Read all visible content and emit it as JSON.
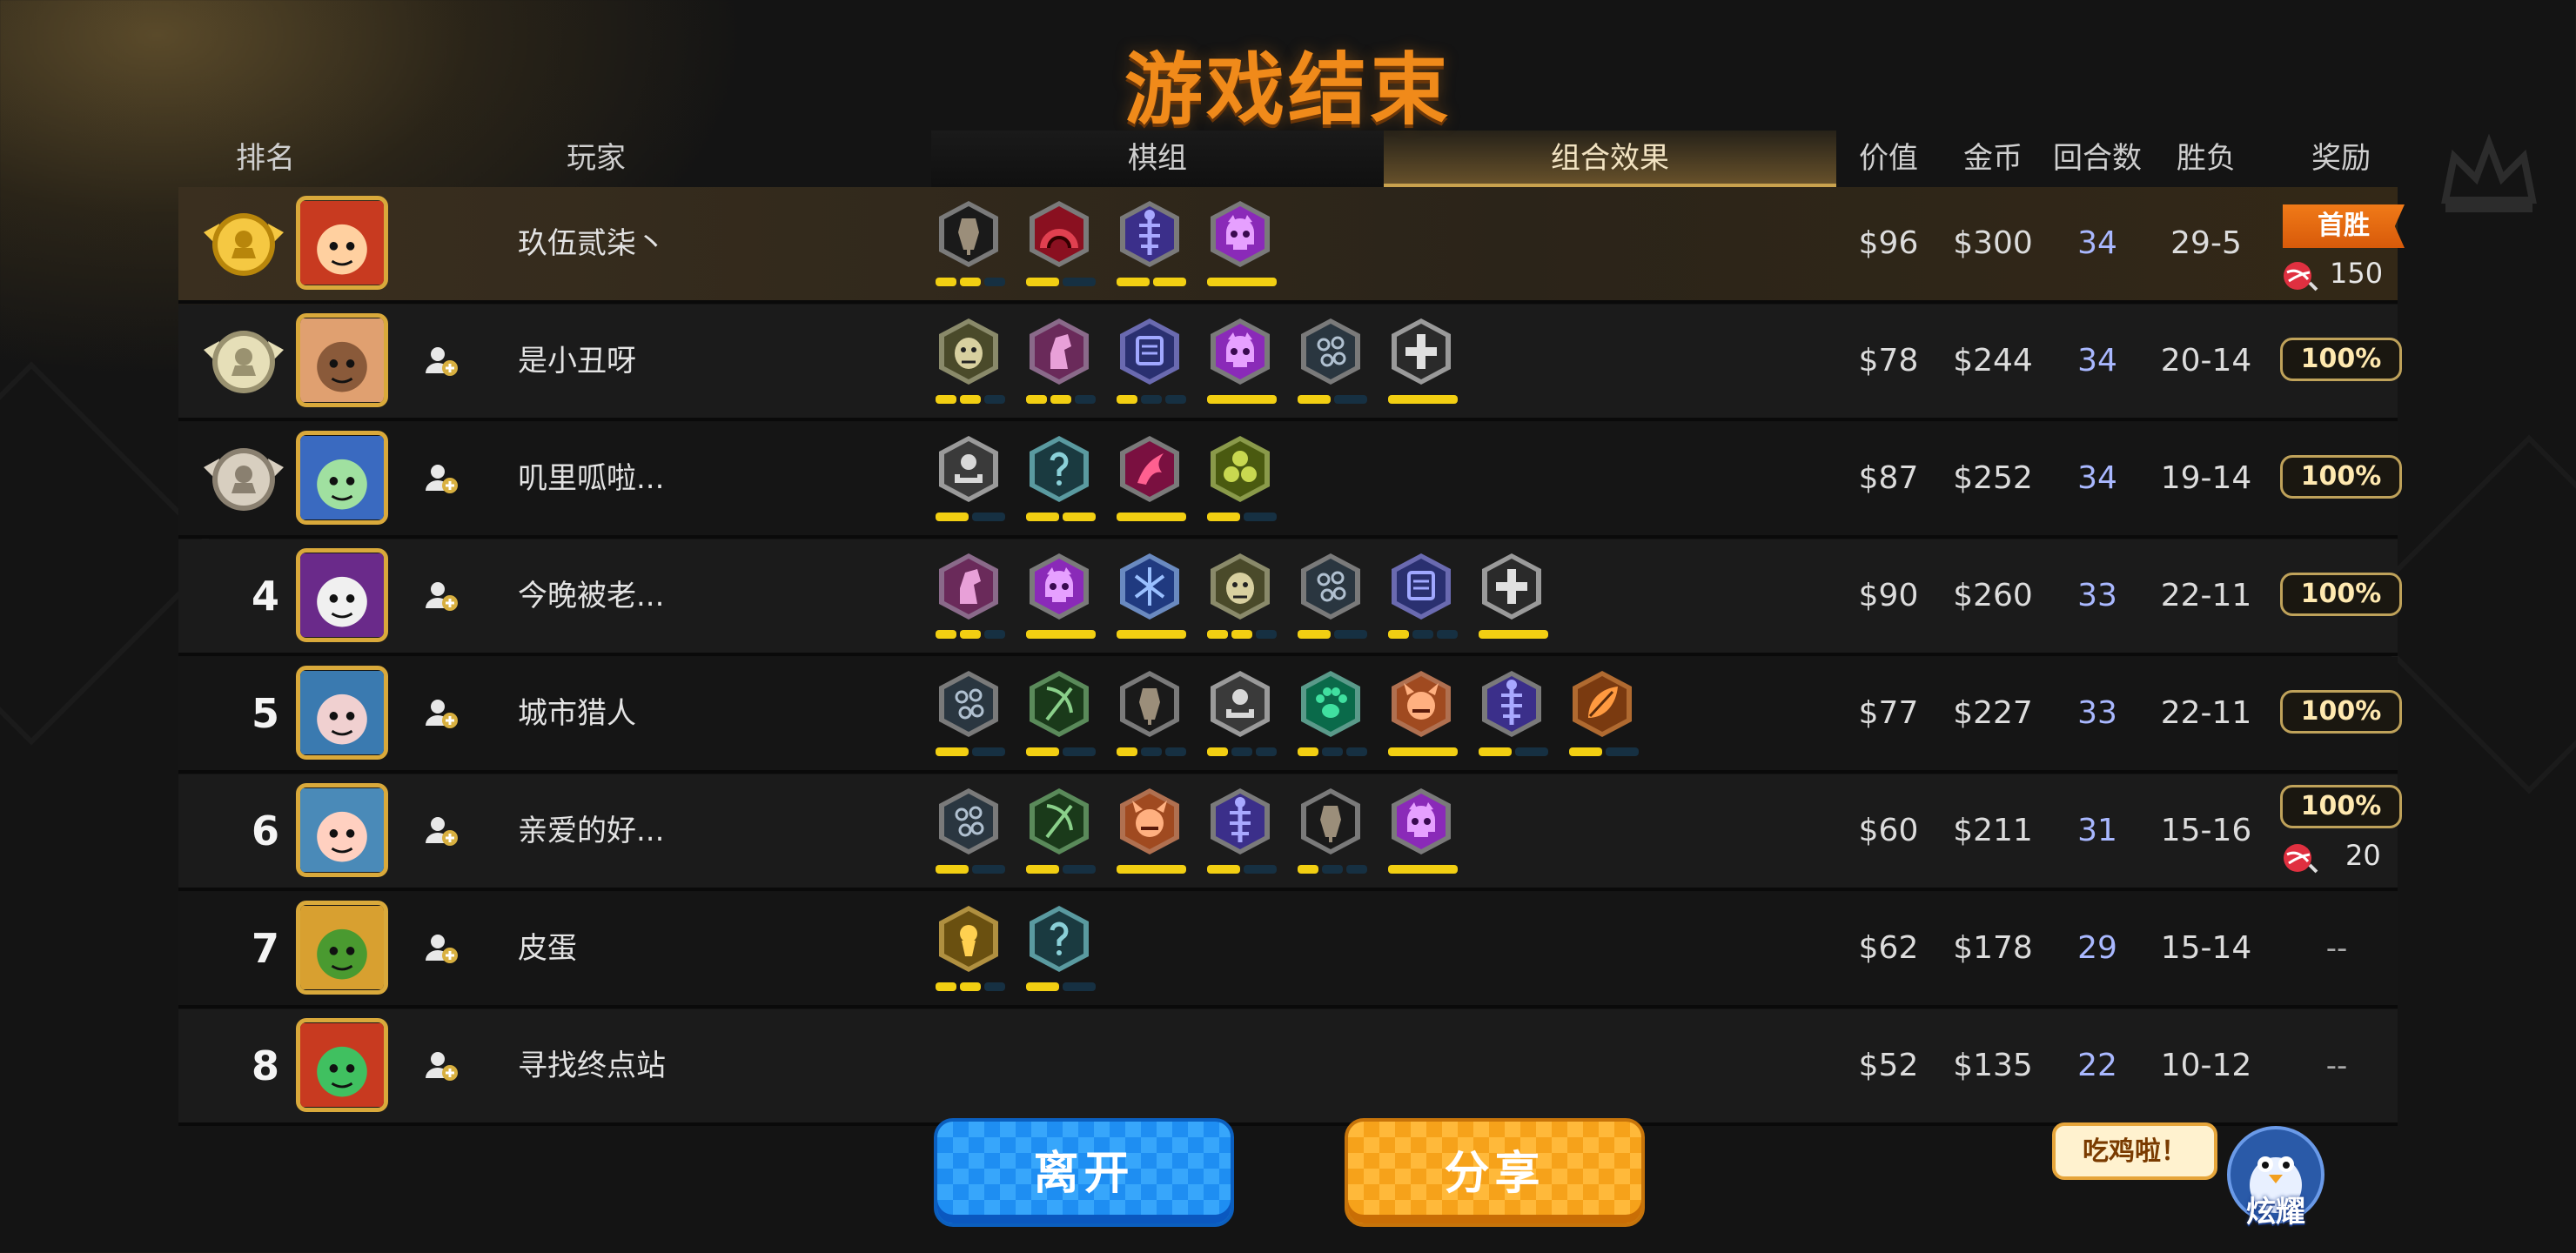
{
  "title": "游戏结束",
  "header": {
    "rank": "排名",
    "player": "玩家",
    "deck_tab": "棋组",
    "combo_tab": "组合效果",
    "value": "价值",
    "gold": "金币",
    "rounds": "回合数",
    "winloss": "胜负",
    "reward": "奖励"
  },
  "colors": {
    "title": "#f08a1a",
    "bar_on": "#f2cf12",
    "bar_off": "#163042",
    "rounds": "#a9b8ff",
    "accent_gold": "#c9a24e"
  },
  "players": [
    {
      "rank": "1",
      "medal": "gold",
      "name": "玖伍贰柒丶",
      "value": "$96",
      "gold": "$300",
      "rounds": "34",
      "winloss": "29-5",
      "reward": {
        "type": "flag",
        "label": "首胜",
        "candy": "150"
      },
      "add_friend": false,
      "traits": [
        {
          "icon": "axe-icon",
          "color": "#1a1a1a",
          "ring": "#7a7a7a",
          "fg": "#9b8e7a",
          "bars": [
            1,
            1,
            0
          ]
        },
        {
          "icon": "arch-icon",
          "color": "#8a1020",
          "ring": "#7a7a7a",
          "fg": "#e04050",
          "bars": [
            1,
            0
          ]
        },
        {
          "icon": "fishbone-icon",
          "color": "#3b2f8a",
          "ring": "#7a7a7a",
          "fg": "#a8a8ff",
          "bars": [
            1,
            1
          ]
        },
        {
          "icon": "skull-icon",
          "color": "#8a2ab8",
          "ring": "#7a7a7a",
          "fg": "#e6a0ff",
          "bars": [
            1
          ]
        }
      ]
    },
    {
      "rank": "2",
      "medal": "silver",
      "name": "是小丑呀",
      "value": "$78",
      "gold": "$244",
      "rounds": "34",
      "winloss": "20-14",
      "reward": {
        "type": "pill",
        "label": "100%"
      },
      "add_friend": true,
      "traits": [
        {
          "icon": "beast-icon",
          "color": "#4a4a2a",
          "ring": "#8a8a6a",
          "fg": "#d8d0a0",
          "bars": [
            1,
            1,
            0
          ]
        },
        {
          "icon": "knight-icon",
          "color": "#6a2a5a",
          "ring": "#8a6a8a",
          "fg": "#e8a0d8",
          "bars": [
            1,
            1,
            0
          ]
        },
        {
          "icon": "scroll-icon",
          "color": "#2a3070",
          "ring": "#6a6ab0",
          "fg": "#a0a8ff",
          "bars": [
            1,
            0,
            0
          ]
        },
        {
          "icon": "skull-icon",
          "color": "#8a2ab8",
          "ring": "#7a7a7a",
          "fg": "#e6a0ff",
          "bars": [
            1
          ]
        },
        {
          "icon": "paw-cluster-icon",
          "color": "#2a3640",
          "ring": "#7a7a7a",
          "fg": "#b0c0d0",
          "bars": [
            1,
            0
          ]
        },
        {
          "icon": "cross-icon",
          "color": "#2a2a2a",
          "ring": "#9a9a9a",
          "fg": "#e0e0e0",
          "bars": [
            1
          ]
        }
      ]
    },
    {
      "rank": "3",
      "medal": "bronze",
      "name": "叽里呱啦...",
      "value": "$87",
      "gold": "$252",
      "rounds": "34",
      "winloss": "19-14",
      "reward": {
        "type": "pill",
        "label": "100%"
      },
      "add_friend": true,
      "traits": [
        {
          "icon": "pedestal-icon",
          "color": "#3a3a3a",
          "ring": "#9a9a9a",
          "fg": "#d8d8d8",
          "bars": [
            1,
            0
          ]
        },
        {
          "icon": "mystery-icon",
          "color": "#1a3a40",
          "ring": "#5a9aa0",
          "fg": "#8ad0d8",
          "bars": [
            1,
            1
          ]
        },
        {
          "icon": "dragon-icon",
          "color": "#7a1040",
          "ring": "#7a7a7a",
          "fg": "#ff6090",
          "bars": [
            1
          ]
        },
        {
          "icon": "triad-icon",
          "color": "#4a5a10",
          "ring": "#8a9a4a",
          "fg": "#c8d850",
          "bars": [
            1,
            0
          ]
        }
      ]
    },
    {
      "rank": "4",
      "medal": "",
      "name": "今晚被老...",
      "value": "$90",
      "gold": "$260",
      "rounds": "33",
      "winloss": "22-11",
      "reward": {
        "type": "pill",
        "label": "100%"
      },
      "add_friend": true,
      "traits": [
        {
          "icon": "knight-icon",
          "color": "#6a2a5a",
          "ring": "#8a6a8a",
          "fg": "#e8a0d8",
          "bars": [
            1,
            1,
            0
          ]
        },
        {
          "icon": "skull-icon",
          "color": "#8a2ab8",
          "ring": "#7a7a7a",
          "fg": "#e6a0ff",
          "bars": [
            1
          ]
        },
        {
          "icon": "shatter-icon",
          "color": "#203a80",
          "ring": "#6a8ac0",
          "fg": "#9ac0ff",
          "bars": [
            1
          ]
        },
        {
          "icon": "beast-icon",
          "color": "#4a4a2a",
          "ring": "#8a8a6a",
          "fg": "#d8d0a0",
          "bars": [
            1,
            1,
            0
          ]
        },
        {
          "icon": "paw-cluster-icon",
          "color": "#2a3640",
          "ring": "#7a7a7a",
          "fg": "#b0c0d0",
          "bars": [
            1,
            0
          ]
        },
        {
          "icon": "scroll-icon",
          "color": "#2a3070",
          "ring": "#6a6ab0",
          "fg": "#a0a8ff",
          "bars": [
            1,
            0,
            0
          ]
        },
        {
          "icon": "cross-icon",
          "color": "#2a2a2a",
          "ring": "#9a9a9a",
          "fg": "#e0e0e0",
          "bars": [
            1
          ]
        }
      ]
    },
    {
      "rank": "5",
      "medal": "",
      "name": "城市猎人",
      "value": "$77",
      "gold": "$227",
      "rounds": "33",
      "winloss": "22-11",
      "reward": {
        "type": "pill",
        "label": "100%"
      },
      "add_friend": true,
      "traits": [
        {
          "icon": "paw-cluster-icon",
          "color": "#2a3640",
          "ring": "#7a7a7a",
          "fg": "#b0c0d0",
          "bars": [
            1,
            0
          ]
        },
        {
          "icon": "bow-icon",
          "color": "#1a3a1a",
          "ring": "#5a8a5a",
          "fg": "#8ad08a",
          "bars": [
            1,
            0
          ]
        },
        {
          "icon": "axe-icon",
          "color": "#1a1a1a",
          "ring": "#7a7a7a",
          "fg": "#9b8e7a",
          "bars": [
            1,
            0,
            0
          ]
        },
        {
          "icon": "pedestal-icon",
          "color": "#3a3a3a",
          "ring": "#9a9a9a",
          "fg": "#d8d8d8",
          "bars": [
            1,
            0,
            0
          ]
        },
        {
          "icon": "paw-icon",
          "color": "#0a6a4a",
          "ring": "#5a9a8a",
          "fg": "#40e0a0",
          "bars": [
            1,
            0,
            0
          ]
        },
        {
          "icon": "demon-icon",
          "color": "#a04a20",
          "ring": "#b07050",
          "fg": "#ffb080",
          "bars": [
            1
          ]
        },
        {
          "icon": "fishbone-icon",
          "color": "#3b2f8a",
          "ring": "#7a7a7a",
          "fg": "#a8a8ff",
          "bars": [
            1,
            0
          ]
        },
        {
          "icon": "leaf-icon",
          "color": "#7a3a10",
          "ring": "#b06a30",
          "fg": "#ff9a40",
          "bars": [
            1,
            0
          ]
        }
      ]
    },
    {
      "rank": "6",
      "medal": "",
      "name": "亲爱的好...",
      "value": "$60",
      "gold": "$211",
      "rounds": "31",
      "winloss": "15-16",
      "reward": {
        "type": "pill_candy",
        "label": "100%",
        "candy": "20"
      },
      "add_friend": true,
      "traits": [
        {
          "icon": "paw-cluster-icon",
          "color": "#2a3640",
          "ring": "#7a7a7a",
          "fg": "#b0c0d0",
          "bars": [
            1,
            0
          ]
        },
        {
          "icon": "bow-icon",
          "color": "#1a3a1a",
          "ring": "#5a8a5a",
          "fg": "#8ad08a",
          "bars": [
            1,
            0
          ]
        },
        {
          "icon": "demon-icon",
          "color": "#a04a20",
          "ring": "#b07050",
          "fg": "#ffb080",
          "bars": [
            1
          ]
        },
        {
          "icon": "fishbone-icon",
          "color": "#3b2f8a",
          "ring": "#7a7a7a",
          "fg": "#a8a8ff",
          "bars": [
            1,
            0
          ]
        },
        {
          "icon": "axe-icon",
          "color": "#1a1a1a",
          "ring": "#7a7a7a",
          "fg": "#9b8e7a",
          "bars": [
            1,
            0,
            0
          ]
        },
        {
          "icon": "skull-icon",
          "color": "#8a2ab8",
          "ring": "#7a7a7a",
          "fg": "#e6a0ff",
          "bars": [
            1
          ]
        }
      ]
    },
    {
      "rank": "7",
      "medal": "",
      "name": "皮蛋",
      "value": "$62",
      "gold": "$178",
      "rounds": "29",
      "winloss": "15-14",
      "reward": {
        "type": "dash",
        "label": "--"
      },
      "add_friend": true,
      "traits": [
        {
          "icon": "keyhole-icon",
          "color": "#6a5010",
          "ring": "#b09040",
          "fg": "#ffd050",
          "bars": [
            1,
            1,
            0
          ]
        },
        {
          "icon": "mystery-icon",
          "color": "#1a3a40",
          "ring": "#5a9aa0",
          "fg": "#8ad0d8",
          "bars": [
            1,
            0
          ]
        }
      ]
    },
    {
      "rank": "8",
      "medal": "",
      "name": "寻找终点站",
      "value": "$52",
      "gold": "$135",
      "rounds": "22",
      "winloss": "10-12",
      "reward": {
        "type": "dash",
        "label": "--"
      },
      "add_friend": true,
      "traits": []
    }
  ],
  "buttons": {
    "leave": "离开",
    "share": "分享"
  },
  "brag": {
    "bubble": "吃鸡啦！",
    "label": "炫耀"
  }
}
